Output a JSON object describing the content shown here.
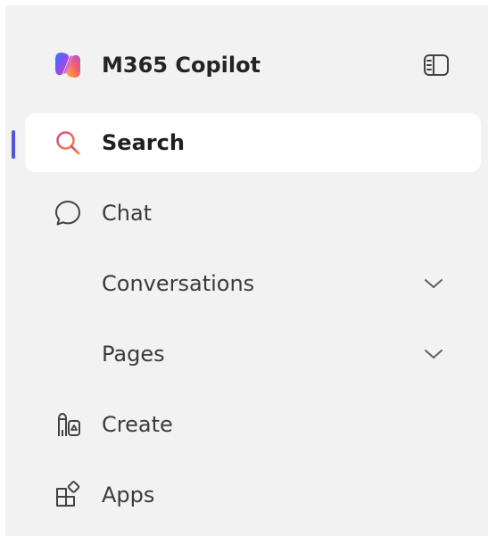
{
  "header": {
    "app_title": "M365 Copilot",
    "logo_icon": "copilot-logo-icon",
    "collapse_icon": "sidebar-toggle-icon"
  },
  "nav": {
    "items": [
      {
        "label": "Search",
        "icon": "search-icon",
        "selected": true
      },
      {
        "label": "Chat",
        "icon": "chat-bubble-icon",
        "selected": false
      },
      {
        "label": "Conversations",
        "icon": "chevron-down-icon",
        "selected": false,
        "expandable": true
      },
      {
        "label": "Pages",
        "icon": "chevron-down-icon",
        "selected": false,
        "expandable": true
      },
      {
        "label": "Create",
        "icon": "create-icon",
        "selected": false
      },
      {
        "label": "Apps",
        "icon": "apps-icon",
        "selected": false
      }
    ]
  },
  "colors": {
    "accent": "#4f52f2",
    "panel_bg": "#f2f2f2",
    "selected_bg": "#ffffff",
    "text": "#3b3b3b",
    "search_icon_start": "#e0417d",
    "search_icon_end": "#f58a3a"
  }
}
